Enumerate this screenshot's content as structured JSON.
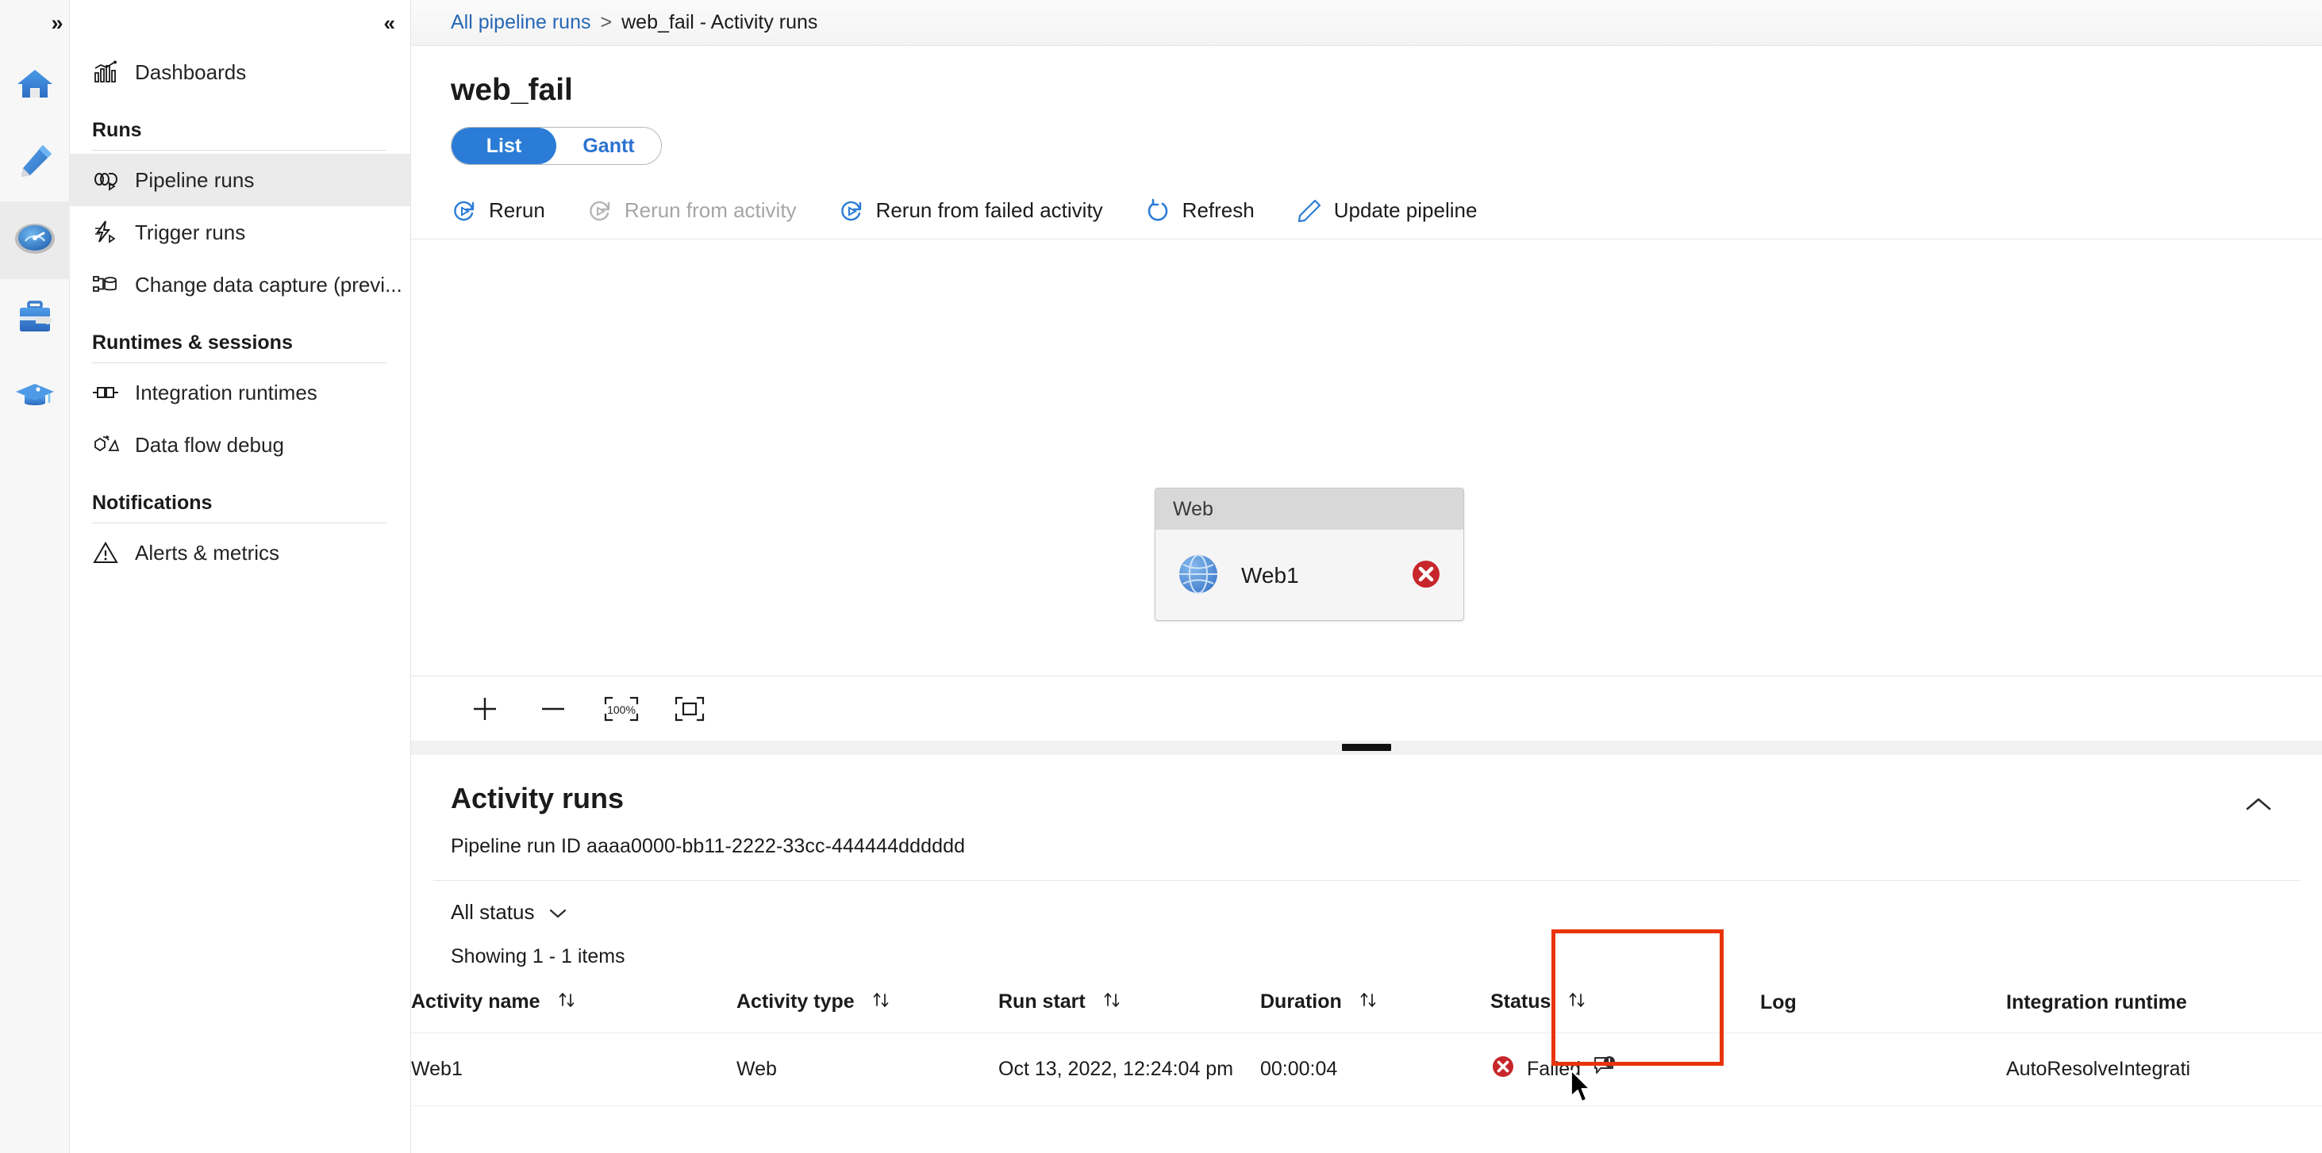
{
  "rail": {
    "expand_label": "»",
    "items": [
      {
        "name": "home",
        "icon": "home-icon",
        "selected": false
      },
      {
        "name": "author",
        "icon": "pencil-icon",
        "selected": false
      },
      {
        "name": "monitor",
        "icon": "gauge-icon",
        "selected": true
      },
      {
        "name": "manage",
        "icon": "toolbox-icon",
        "selected": false
      },
      {
        "name": "learn",
        "icon": "graduation-cap-icon",
        "selected": false
      }
    ]
  },
  "sidebar": {
    "collapse_label": "«",
    "dashboards": {
      "label": "Dashboards",
      "icon": "dashboards-chart-icon"
    },
    "groups": [
      {
        "title": "Runs",
        "items": [
          {
            "label": "Pipeline runs",
            "icon": "pipeline-runs-icon",
            "selected": true
          },
          {
            "label": "Trigger runs",
            "icon": "lightning-bolt-icon",
            "selected": false
          },
          {
            "label": "Change data capture (previ...",
            "icon": "change-data-capture-icon",
            "selected": false
          }
        ]
      },
      {
        "title": "Runtimes & sessions",
        "items": [
          {
            "label": "Integration runtimes",
            "icon": "integration-runtime-icon",
            "selected": false
          },
          {
            "label": "Data flow debug",
            "icon": "data-flow-debug-icon",
            "selected": false
          }
        ]
      },
      {
        "title": "Notifications",
        "items": [
          {
            "label": "Alerts & metrics",
            "icon": "alert-triangle-icon",
            "selected": false
          }
        ]
      }
    ]
  },
  "breadcrumb": {
    "root": "All pipeline runs",
    "separator": ">",
    "current": "web_fail - Activity runs"
  },
  "page": {
    "title": "web_fail"
  },
  "view_toggle": {
    "list": "List",
    "gantt": "Gantt",
    "active": "List"
  },
  "toolbar": {
    "rerun": "Rerun",
    "rerun_from_activity": "Rerun from activity",
    "rerun_from_failed_activity": "Rerun from failed activity",
    "refresh": "Refresh",
    "update_pipeline": "Update pipeline"
  },
  "canvas": {
    "node": {
      "type_label": "Web",
      "name": "Web1",
      "status_icon": "failed-error-icon"
    },
    "zoom_controls": {
      "zoom_in": "+",
      "zoom_out": "—",
      "zoom_level": "100%",
      "fit_to_screen": "fit-to-screen-icon"
    }
  },
  "activity_runs": {
    "title": "Activity runs",
    "collapse_icon": "chevron-up-icon",
    "pipeline_run_id_label": "Pipeline run ID",
    "pipeline_run_id_value": "aaaa0000-bb11-2222-33cc-444444dddddd",
    "status_filter": "All status",
    "showing": "Showing 1 - 1 items",
    "columns": [
      {
        "label": "Activity name",
        "sortable": true
      },
      {
        "label": "Activity type",
        "sortable": true
      },
      {
        "label": "Run start",
        "sortable": true
      },
      {
        "label": "Duration",
        "sortable": true
      },
      {
        "label": "Status",
        "sortable": true
      },
      {
        "label": "Log",
        "sortable": false
      },
      {
        "label": "Integration runtime",
        "sortable": false
      }
    ],
    "rows": [
      {
        "activity_name": "Web1",
        "activity_type": "Web",
        "run_start": "Oct 13, 2022, 12:24:04 pm",
        "duration": "00:00:04",
        "status": "Failed",
        "status_icon": "failed-error-icon",
        "error_detail_icon": "error-bubble-icon",
        "log": "",
        "integration_runtime": "AutoResolveIntegrati"
      }
    ]
  },
  "colors": {
    "accent_blue": "#2b7cd6",
    "link_blue": "#2767b5",
    "fail_red": "#d03030",
    "highlight_red": "#e8340c",
    "selected_gray": "#ebebeb"
  }
}
